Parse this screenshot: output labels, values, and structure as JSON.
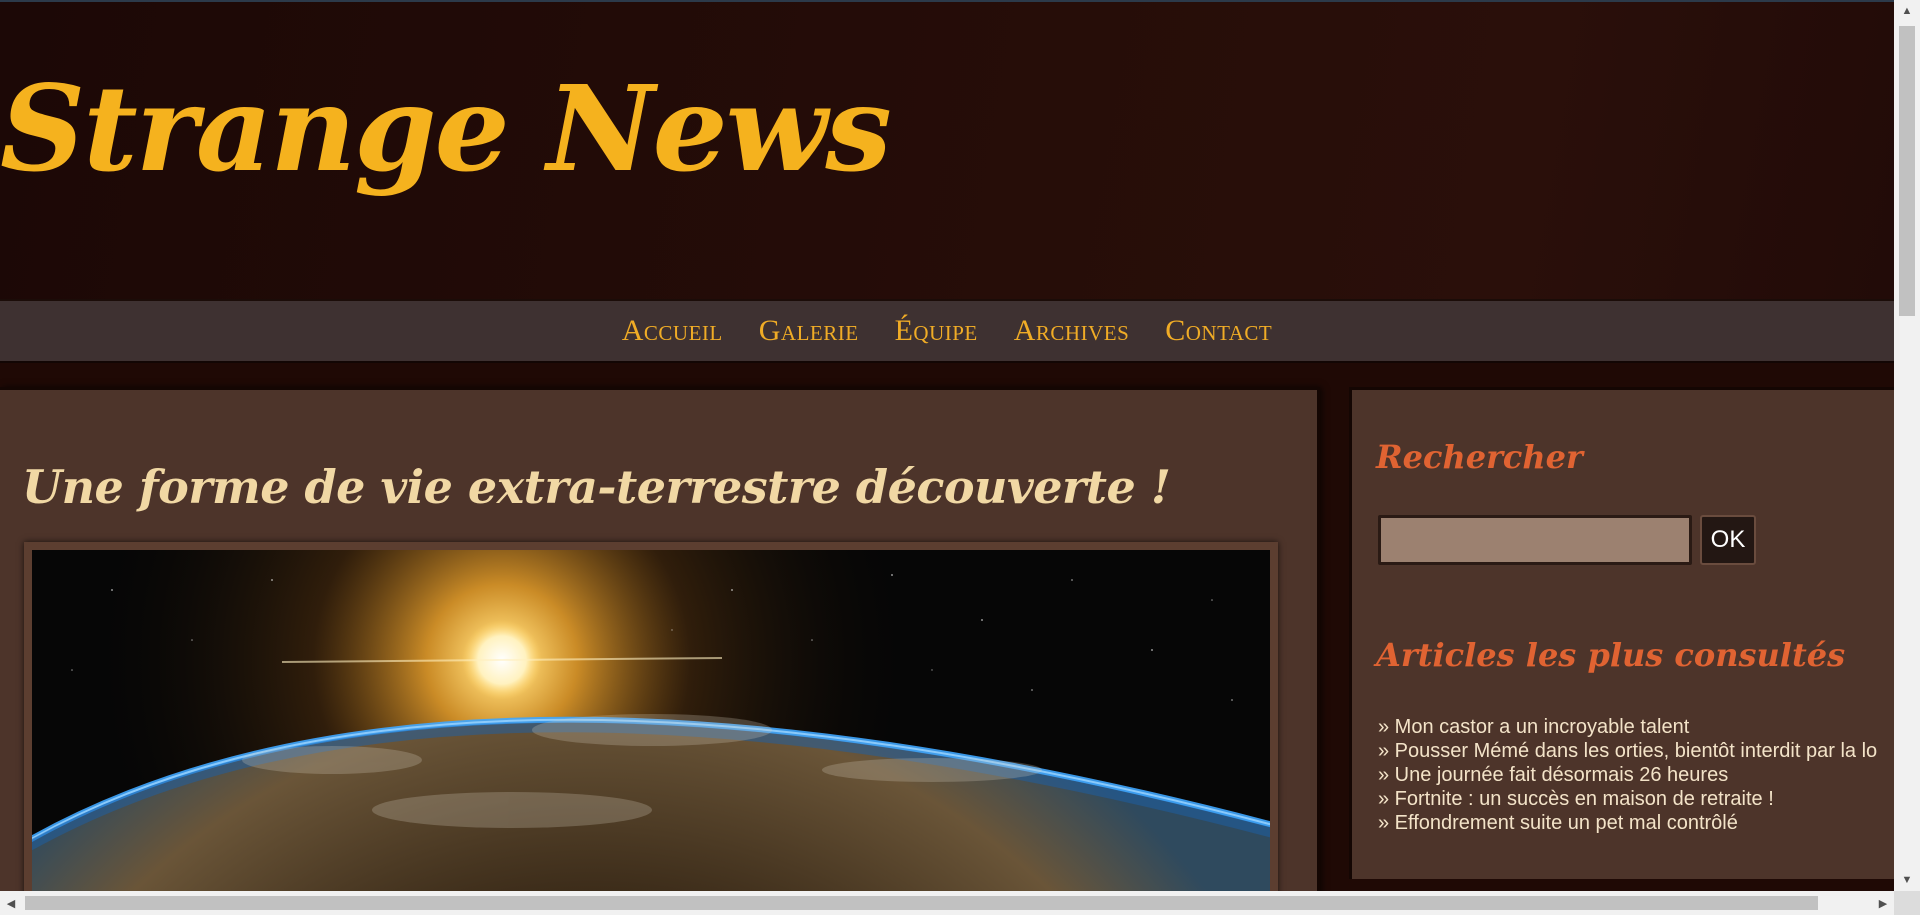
{
  "site": {
    "title": "Strange News"
  },
  "nav": {
    "items": [
      {
        "label": "Accueil"
      },
      {
        "label": "Galerie"
      },
      {
        "label": "Équipe"
      },
      {
        "label": "Archives"
      },
      {
        "label": "Contact"
      }
    ]
  },
  "article": {
    "title": "Une forme de vie extra-terrestre découverte !",
    "image_icon": "earth-sunrise-image"
  },
  "sidebar": {
    "search": {
      "heading": "Rechercher",
      "input_value": "",
      "button_label": "OK"
    },
    "popular": {
      "heading": "Articles les plus consultés",
      "items": [
        {
          "label": "» Mon castor a un incroyable talent"
        },
        {
          "label": "» Pousser Mémé dans les orties, bientôt interdit par la lo"
        },
        {
          "label": "» Une journée fait désormais 26 heures"
        },
        {
          "label": "» Fortnite : un succès en maison de retraite !"
        },
        {
          "label": "» Effondrement suite un pet mal contrôlé"
        }
      ]
    }
  },
  "colors": {
    "accent": "#f5b21e",
    "article_title": "#f1d8a4",
    "sidebar_heading": "#e06332",
    "panel_bg": "#4d342a"
  }
}
